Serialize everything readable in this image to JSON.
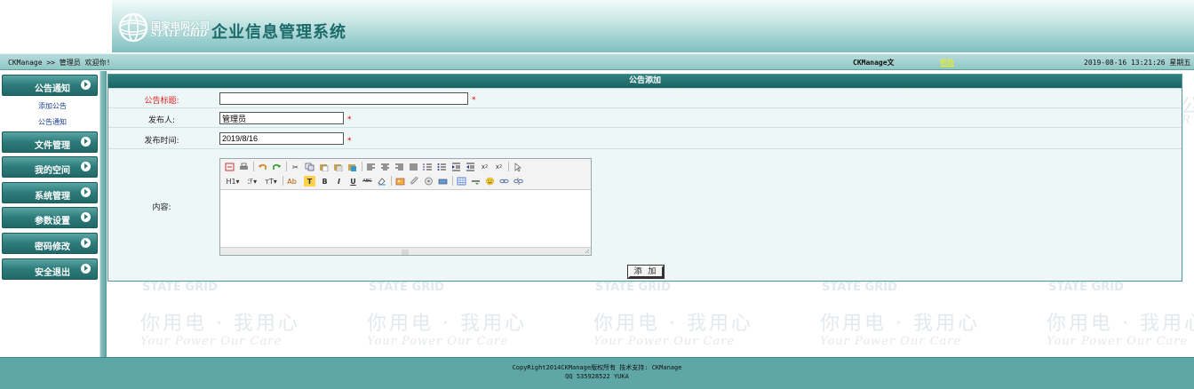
{
  "header": {
    "logo_cn": "国家电网公司",
    "logo_en": "STATE GRID",
    "system_title": "企业信息管理系统"
  },
  "infobar": {
    "breadcrumb": "CKManage >> 管理员 欢迎你!",
    "center_label": "CKManage文",
    "help_label": "帮助",
    "datetime": "2019-08-16 13:21:26 星期五"
  },
  "sidebar": {
    "menu": [
      {
        "label": "公告通知"
      },
      {
        "label": "文件管理"
      },
      {
        "label": "我的空间"
      },
      {
        "label": "系统管理"
      },
      {
        "label": "参数设置"
      },
      {
        "label": "密码修改"
      },
      {
        "label": "安全退出"
      }
    ],
    "submenu": [
      {
        "label": "添加公告"
      },
      {
        "label": "公告通知"
      }
    ]
  },
  "form": {
    "panel_title": "公告添加",
    "title_label": "公告标题:",
    "title_value": "",
    "publisher_label": "发布人:",
    "publisher_value": "管理员",
    "date_label": "发布时间:",
    "date_value": "2019/8/16",
    "content_label": "内容:",
    "required_mark": "*",
    "submit_label": "添 加"
  },
  "editor": {
    "toolbar_row1": [
      "fullscreen-icon",
      "print-icon",
      "undo-icon",
      "redo-icon",
      "cut-icon",
      "copy-icon",
      "paste-icon",
      "paste-text-icon",
      "paste-word-icon",
      "align-left-icon",
      "align-center-icon",
      "align-right-icon",
      "align-justify-icon",
      "ordered-list-icon",
      "unordered-list-icon",
      "indent-icon",
      "outdent-icon",
      "subscript-icon",
      "superscript-icon",
      "select-icon"
    ],
    "toolbar_row2_text": {
      "h1": "H1",
      "font": "ℱ",
      "size": "тT",
      "forecolor": "Ab",
      "backcolor": "T",
      "bold": "B",
      "italic": "I",
      "underline": "U",
      "strike": "ABC"
    }
  },
  "watermark": {
    "top_text": "STATE GRID",
    "slogan_cn": "你用电 · 我用心",
    "slogan_en": "Your Power  Our Care",
    "edge_cn": "公",
    "edge_en": "R"
  },
  "footer": {
    "line1": "CopyRight2014CKManage版权所有 技术支持: CKManage",
    "line2": "QQ 535928522 YUKA"
  },
  "colors": {
    "primary_teal": "#2c7b7a",
    "footer": "#5fa7a7",
    "required": "#e00000",
    "help_link": "#f4f400"
  }
}
